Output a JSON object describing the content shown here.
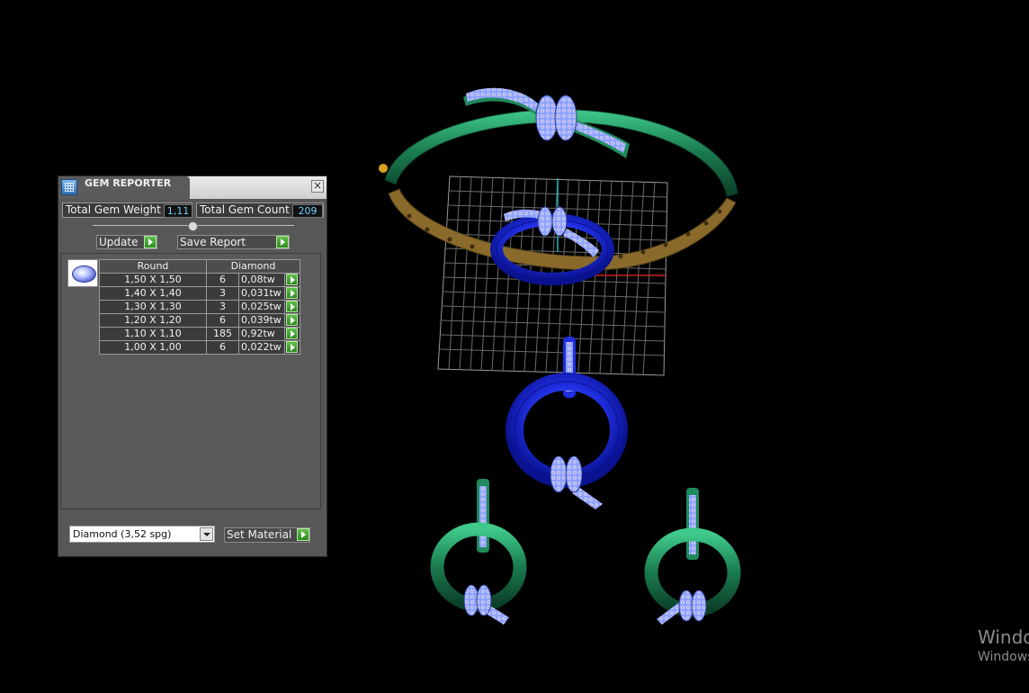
{
  "panel": {
    "title": "GEM REPORTER",
    "close_glyph": "×",
    "total_weight_label": "Total Gem Weight",
    "total_weight_value": "1,11",
    "total_count_label": "Total Gem Count",
    "total_count_value": "209",
    "update_label": "Update",
    "save_report_label": "Save Report",
    "table": {
      "header_shape": "Round",
      "header_material": "Diamond",
      "rows": [
        {
          "size": "1,50 X 1,50",
          "count": "6",
          "weight": "0,08tw"
        },
        {
          "size": "1,40 X 1,40",
          "count": "3",
          "weight": "0,031tw"
        },
        {
          "size": "1,30 X 1,30",
          "count": "3",
          "weight": "0,025tw"
        },
        {
          "size": "1,20 X 1,20",
          "count": "6",
          "weight": "0,039tw"
        },
        {
          "size": "1,10 X 1,10",
          "count": "185",
          "weight": "0,92tw"
        },
        {
          "size": "1,00 X 1,00",
          "count": "6",
          "weight": "0,022tw"
        }
      ]
    },
    "material_select_value": "Diamond      (3,52 spg)",
    "set_material_label": "Set Material"
  },
  "watermark": {
    "line1": "Windo",
    "line2": "Windows"
  },
  "colors": {
    "background": "#000000",
    "panel": "#575757",
    "value_text": "#6fd0ff",
    "green_metal": "#1f8a5c",
    "blue_metal": "#1f2fe0",
    "gold_metal": "#8a6a2b",
    "gem": "#b9c6ff"
  },
  "icons": [
    "gem-reporter-app-icon",
    "close-icon",
    "play-icon",
    "round-gem-icon",
    "chevron-down-icon"
  ]
}
